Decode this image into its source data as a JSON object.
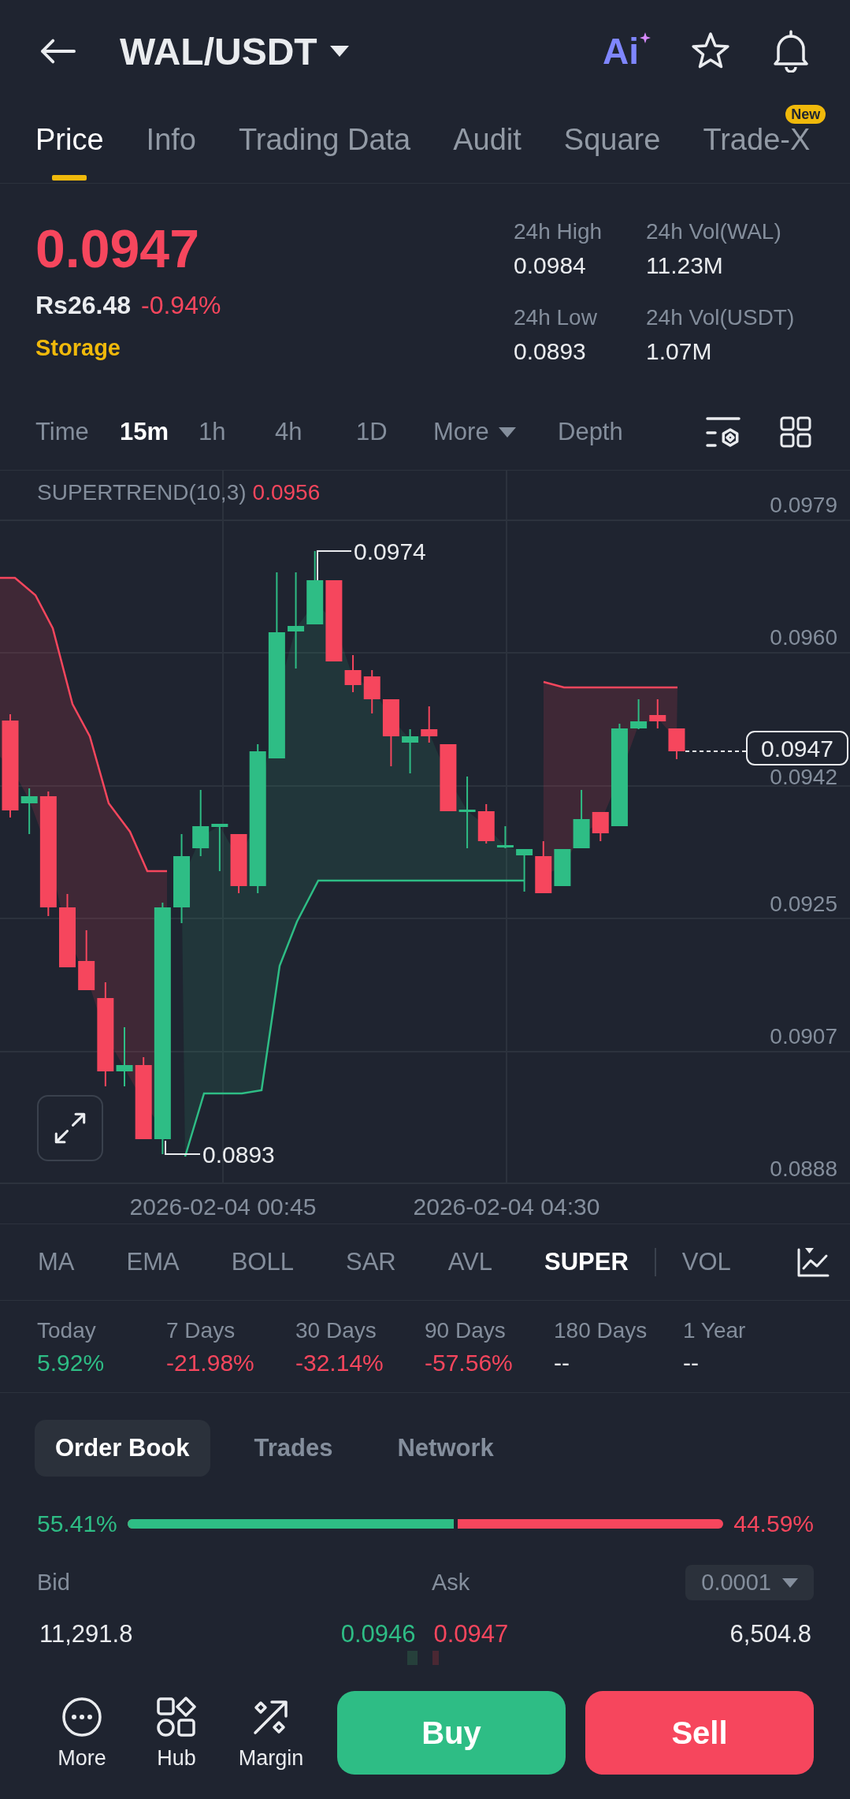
{
  "header": {
    "title": "WAL/USDT",
    "ai_label": "Ai"
  },
  "tabs": [
    {
      "label": "Price",
      "selected": true
    },
    {
      "label": "Info",
      "selected": false
    },
    {
      "label": "Trading Data",
      "selected": false
    },
    {
      "label": "Audit",
      "selected": false
    },
    {
      "label": "Square",
      "selected": false
    },
    {
      "label": "Trade-X",
      "selected": false,
      "badge": "New"
    }
  ],
  "ticker": {
    "price": "0.0947",
    "fiat_price": "Rs26.48",
    "change": "-0.94%",
    "falling": true,
    "tag": "Storage",
    "stats": [
      {
        "label": "24h High",
        "value": "0.0984"
      },
      {
        "label": "24h Vol(WAL)",
        "value": "11.23M"
      },
      {
        "label": "24h Low",
        "value": "0.0893"
      },
      {
        "label": "24h Vol(USDT)",
        "value": "1.07M"
      }
    ]
  },
  "intervals": [
    {
      "label": "Time",
      "kind": "tab",
      "selected": false
    },
    {
      "label": "15m",
      "kind": "tab",
      "selected": true
    },
    {
      "label": "1h",
      "kind": "tab",
      "selected": false
    },
    {
      "label": "4h",
      "kind": "tab",
      "selected": false
    },
    {
      "label": "1D",
      "kind": "tab",
      "selected": false
    },
    {
      "label": "More",
      "kind": "dropdown",
      "selected": false
    },
    {
      "label": "Depth",
      "kind": "tab",
      "selected": false
    }
  ],
  "chart": {
    "indicator": "SUPERTREND(10,3)",
    "indicator_value": "0.0956",
    "y_axis": [
      "0.0979",
      "0.0960",
      "0.0942",
      "0.0925",
      "0.0907",
      "0.0888"
    ],
    "high_label": "0.0974",
    "low_label": "0.0893",
    "last_price": "0.0947",
    "x_axis": [
      "2026-02-04 00:45",
      "2026-02-04 04:30"
    ]
  },
  "indicators": {
    "main": [
      {
        "label": "MA",
        "selected": false
      },
      {
        "label": "EMA",
        "selected": false
      },
      {
        "label": "BOLL",
        "selected": false
      },
      {
        "label": "SAR",
        "selected": false
      },
      {
        "label": "AVL",
        "selected": false
      },
      {
        "label": "SUPER",
        "selected": true
      }
    ],
    "sub": [
      {
        "label": "VOL",
        "selected": false
      }
    ]
  },
  "performance": [
    {
      "period": "Today",
      "change": "5.92%",
      "kind": "gain"
    },
    {
      "period": "7 Days",
      "change": "-21.98%",
      "kind": "loss"
    },
    {
      "period": "30 Days",
      "change": "-32.14%",
      "kind": "loss"
    },
    {
      "period": "90 Days",
      "change": "-57.56%",
      "kind": "loss"
    },
    {
      "period": "180 Days",
      "change": "--",
      "kind": "flat"
    },
    {
      "period": "1 Year",
      "change": "--",
      "kind": "flat"
    }
  ],
  "order_book": {
    "tabs": [
      {
        "label": "Order Book",
        "selected": true
      },
      {
        "label": "Trades",
        "selected": false
      },
      {
        "label": "Network",
        "selected": false
      }
    ],
    "bid_share": "55.41%",
    "ask_share": "44.59%",
    "level": 0.5541,
    "bid_header": "Bid",
    "ask_header": "Ask",
    "precision": "0.0001",
    "rows": [
      {
        "bid_amount": "11,291.8",
        "bid_price": "0.0946",
        "ask_price": "0.0947",
        "ask_amount": "6,504.8"
      }
    ]
  },
  "actions": [
    {
      "label": "More",
      "kind": "more"
    },
    {
      "label": "Hub",
      "kind": "hub"
    },
    {
      "label": "Margin",
      "kind": "margin"
    }
  ],
  "trade_buttons": {
    "buy": "Buy",
    "sell": "Sell"
  }
}
